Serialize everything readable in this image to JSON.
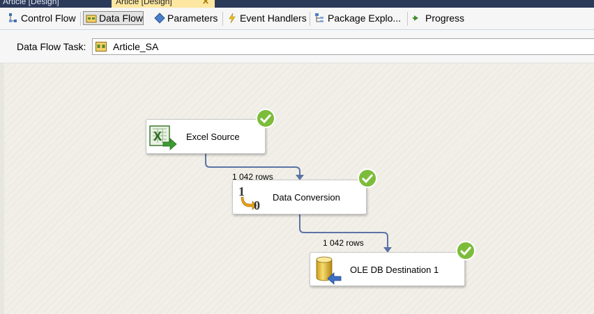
{
  "doc_tabs": [
    {
      "label": "Article [Design]",
      "active": false
    },
    {
      "label": "Article [Design]",
      "active": true
    }
  ],
  "designer_tabs": [
    {
      "label": "Control Flow",
      "icon": "control-flow-icon",
      "active": false
    },
    {
      "label": "Data Flow",
      "icon": "data-flow-icon",
      "active": true
    },
    {
      "label": "Parameters",
      "icon": "parameters-icon",
      "active": false
    },
    {
      "label": "Event Handlers",
      "icon": "lightning-icon",
      "active": false
    },
    {
      "label": "Package Explo...",
      "icon": "package-explorer-icon",
      "active": false
    },
    {
      "label": "Progress",
      "icon": "progress-arrow-icon",
      "active": false
    }
  ],
  "task": {
    "label": "Data Flow Task:",
    "value": "Article_SA"
  },
  "nodes": [
    {
      "label": "Excel Source",
      "icon": "excel-source-icon",
      "status": "success"
    },
    {
      "label": "Data Conversion",
      "icon": "data-conversion-icon",
      "status": "success"
    },
    {
      "label": "OLE DB Destination 1",
      "icon": "oledb-destination-icon",
      "status": "success"
    }
  ],
  "paths": [
    {
      "rows": "1 042 rows"
    },
    {
      "rows": "1 042 rows"
    }
  ],
  "colors": {
    "path": "#5b74a5",
    "check": "#7cbc3a",
    "active_tab": "#fde7a0"
  }
}
